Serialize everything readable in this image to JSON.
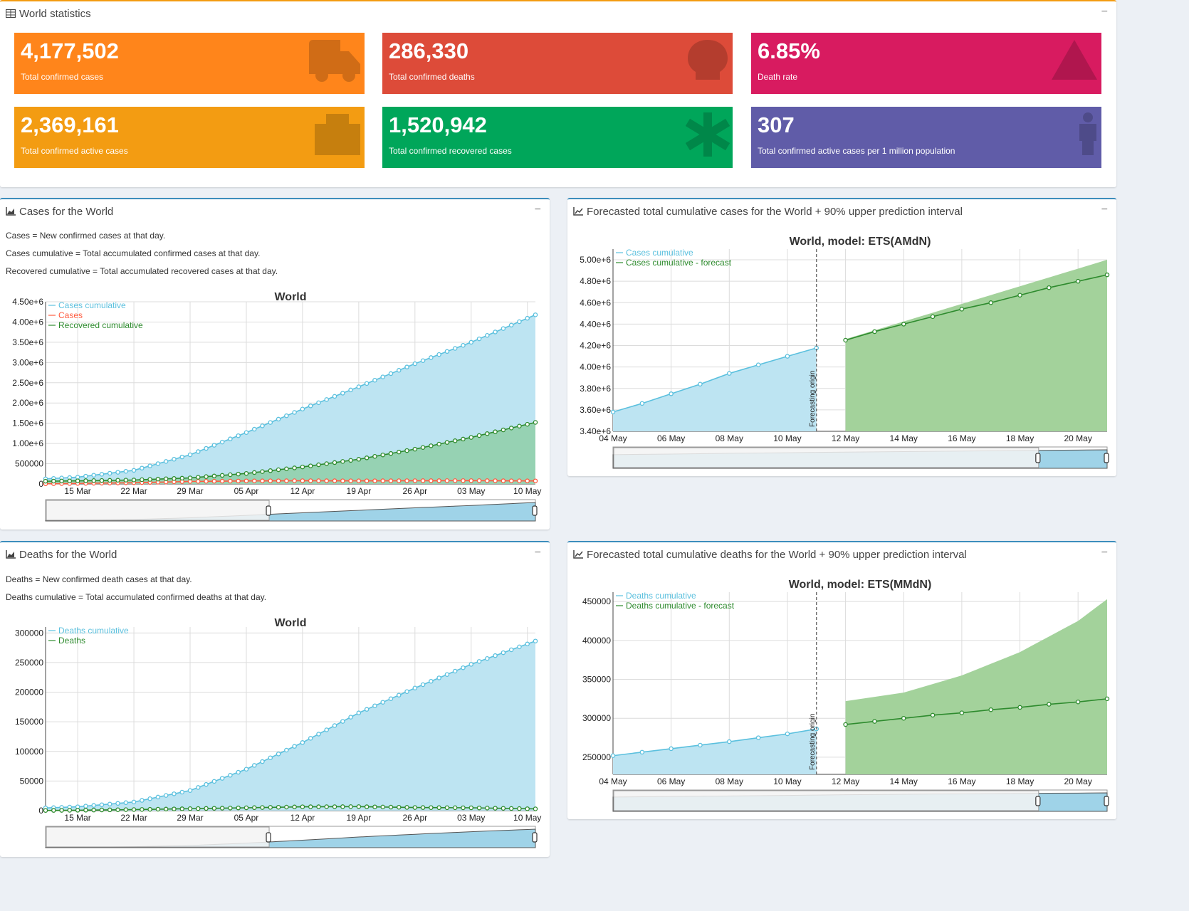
{
  "world_stats": {
    "title": "World statistics",
    "boxes": [
      {
        "value": "4,177,502",
        "label": "Total confirmed cases",
        "color": "#ff851b",
        "icon": "ambulance-icon"
      },
      {
        "value": "286,330",
        "label": "Total confirmed deaths",
        "color": "#dd4b39",
        "icon": "skull-icon"
      },
      {
        "value": "6.85%",
        "label": "Death rate",
        "color": "#d81b60",
        "icon": "warning-icon"
      },
      {
        "value": "2,369,161",
        "label": "Total confirmed active cases",
        "color": "#f39c12",
        "icon": "hospital-icon"
      },
      {
        "value": "1,520,942",
        "label": "Total confirmed recovered cases",
        "color": "#00a65a",
        "icon": "asterisk-icon"
      },
      {
        "value": "307",
        "label": "Total confirmed active cases per 1 million population",
        "color": "#605ca8",
        "icon": "person-icon"
      }
    ]
  },
  "panels": {
    "cases": {
      "title": "Cases for the World",
      "desc": [
        "Cases = New confirmed cases at that day.",
        "Cases cumulative = Total accumulated confirmed cases at that day.",
        "Recovered cumulative = Total accumulated recovered cases at that day."
      ]
    },
    "forecast_cases": {
      "title": "Forecasted total cumulative cases for the World + 90% upper prediction interval"
    },
    "deaths": {
      "title": "Deaths for the World",
      "desc": [
        "Deaths = New confirmed death cases at that day.",
        "Deaths cumulative = Total accumulated confirmed deaths at that day."
      ]
    },
    "forecast_deaths": {
      "title": "Forecasted total cumulative deaths for the World + 90% upper prediction interval"
    }
  },
  "chart_data": [
    {
      "id": "cases",
      "type": "area",
      "title": "World",
      "x_start": "2020-03-11",
      "x_end": "2020-05-11",
      "xticks": [
        "15 Mar",
        "22 Mar",
        "29 Mar",
        "05 Apr",
        "12 Apr",
        "19 Apr",
        "26 Apr",
        "03 May",
        "10 May"
      ],
      "yticks": [
        "0",
        "500000",
        "1.00e+6",
        "1.50e+6",
        "2.00e+6",
        "2.50e+6",
        "3.00e+6",
        "3.50e+6",
        "4.00e+6",
        "4.50e+6"
      ],
      "ylim": [
        0,
        4500000
      ],
      "legend_position": "top-left",
      "series": [
        {
          "name": "Cases cumulative",
          "color": "#5bc0de",
          "fill": "#bde4f2",
          "points": [
            [
              "2020-03-11",
              126000
            ],
            [
              "2020-03-15",
              168000
            ],
            [
              "2020-03-22",
              337000
            ],
            [
              "2020-03-29",
              721000
            ],
            [
              "2020-04-05",
              1270000
            ],
            [
              "2020-04-12",
              1850000
            ],
            [
              "2020-04-19",
              2400000
            ],
            [
              "2020-04-26",
              2970000
            ],
            [
              "2020-05-03",
              3500000
            ],
            [
              "2020-05-11",
              4177502
            ]
          ]
        },
        {
          "name": "Cases",
          "color": "#ff5b3f",
          "fill": null,
          "points": [
            [
              "2020-03-11",
              5000
            ],
            [
              "2020-03-15",
              13000
            ],
            [
              "2020-03-22",
              30000
            ],
            [
              "2020-03-29",
              62000
            ],
            [
              "2020-04-05",
              75000
            ],
            [
              "2020-04-12",
              80000
            ],
            [
              "2020-04-19",
              77000
            ],
            [
              "2020-04-26",
              80000
            ],
            [
              "2020-05-03",
              82000
            ],
            [
              "2020-05-11",
              75000
            ]
          ]
        },
        {
          "name": "Recovered cumulative",
          "color": "#2e8b2e",
          "fill": "#8fcfa8",
          "points": [
            [
              "2020-03-11",
              68000
            ],
            [
              "2020-03-15",
              78000
            ],
            [
              "2020-03-22",
              98000
            ],
            [
              "2020-03-29",
              150000
            ],
            [
              "2020-04-05",
              260000
            ],
            [
              "2020-04-12",
              420000
            ],
            [
              "2020-04-19",
              610000
            ],
            [
              "2020-04-26",
              860000
            ],
            [
              "2020-05-03",
              1150000
            ],
            [
              "2020-05-11",
              1520942
            ]
          ]
        }
      ]
    },
    {
      "id": "forecast_cases",
      "type": "line",
      "title": "World, model: ETS(AMdN)",
      "x_start": "2020-05-04",
      "x_end": "2020-05-21",
      "xticks": [
        "04 May",
        "06 May",
        "08 May",
        "10 May",
        "12 May",
        "14 May",
        "16 May",
        "18 May",
        "20 May"
      ],
      "yticks": [
        "3.40e+6",
        "3.60e+6",
        "3.80e+6",
        "4.00e+6",
        "4.20e+6",
        "4.40e+6",
        "4.60e+6",
        "4.80e+6",
        "5.00e+6"
      ],
      "ylim": [
        3400000,
        5100000
      ],
      "legend_position": "top-left",
      "annotation": "Forecasting origin",
      "origin": "2020-05-11",
      "series": [
        {
          "name": "Cases cumulative",
          "color": "#5bc0de",
          "fill": "#bde4f2",
          "points": [
            [
              "2020-05-04",
              3580000
            ],
            [
              "2020-05-05",
              3660000
            ],
            [
              "2020-05-06",
              3750000
            ],
            [
              "2020-05-07",
              3840000
            ],
            [
              "2020-05-08",
              3940000
            ],
            [
              "2020-05-09",
              4020000
            ],
            [
              "2020-05-10",
              4100000
            ],
            [
              "2020-05-11",
              4177502
            ]
          ]
        },
        {
          "name": "Cases cumulative - forecast",
          "color": "#2e8b2e",
          "fill": "#a3d29b",
          "points": [
            [
              "2020-05-12",
              4250000
            ],
            [
              "2020-05-13",
              4330000
            ],
            [
              "2020-05-14",
              4400000
            ],
            [
              "2020-05-15",
              4470000
            ],
            [
              "2020-05-16",
              4540000
            ],
            [
              "2020-05-17",
              4600000
            ],
            [
              "2020-05-18",
              4670000
            ],
            [
              "2020-05-19",
              4740000
            ],
            [
              "2020-05-20",
              4800000
            ],
            [
              "2020-05-21",
              4860000
            ]
          ]
        }
      ],
      "upper_interval": [
        [
          "2020-05-12",
          4260000
        ],
        [
          "2020-05-21",
          5000000
        ]
      ]
    },
    {
      "id": "deaths",
      "type": "area",
      "title": "World",
      "x_start": "2020-03-11",
      "x_end": "2020-05-11",
      "xticks": [
        "15 Mar",
        "22 Mar",
        "29 Mar",
        "05 Apr",
        "12 Apr",
        "19 Apr",
        "26 Apr",
        "03 May",
        "10 May"
      ],
      "yticks": [
        "0",
        "50000",
        "100000",
        "150000",
        "200000",
        "250000",
        "300000"
      ],
      "ylim": [
        0,
        310000
      ],
      "legend_position": "top-left",
      "series": [
        {
          "name": "Deaths cumulative",
          "color": "#5bc0de",
          "fill": "#bde4f2",
          "points": [
            [
              "2020-03-11",
              4600
            ],
            [
              "2020-03-15",
              6500
            ],
            [
              "2020-03-22",
              14600
            ],
            [
              "2020-03-29",
              34000
            ],
            [
              "2020-04-05",
              70000
            ],
            [
              "2020-04-12",
              115000
            ],
            [
              "2020-04-19",
              165000
            ],
            [
              "2020-04-26",
              207000
            ],
            [
              "2020-05-03",
              247000
            ],
            [
              "2020-05-11",
              286330
            ]
          ]
        },
        {
          "name": "Deaths",
          "color": "#2e8b2e",
          "fill": null,
          "points": [
            [
              "2020-03-11",
              300
            ],
            [
              "2020-03-15",
              700
            ],
            [
              "2020-03-22",
              1800
            ],
            [
              "2020-03-29",
              3300
            ],
            [
              "2020-04-05",
              4800
            ],
            [
              "2020-04-12",
              6500
            ],
            [
              "2020-04-19",
              6800
            ],
            [
              "2020-04-26",
              5300
            ],
            [
              "2020-05-03",
              4800
            ],
            [
              "2020-05-11",
              3000
            ]
          ]
        }
      ]
    },
    {
      "id": "forecast_deaths",
      "type": "line",
      "title": "World, model: ETS(MMdN)",
      "x_start": "2020-05-04",
      "x_end": "2020-05-21",
      "xticks": [
        "04 May",
        "06 May",
        "08 May",
        "10 May",
        "12 May",
        "14 May",
        "16 May",
        "18 May",
        "20 May"
      ],
      "yticks": [
        "250000",
        "300000",
        "350000",
        "400000",
        "450000"
      ],
      "ylim": [
        228000,
        462000
      ],
      "legend_position": "top-left",
      "annotation": "Forecasting origin",
      "origin": "2020-05-11",
      "series": [
        {
          "name": "Deaths cumulative",
          "color": "#5bc0de",
          "fill": "#bde4f2",
          "points": [
            [
              "2020-05-04",
              252000
            ],
            [
              "2020-05-05",
              256500
            ],
            [
              "2020-05-06",
              261000
            ],
            [
              "2020-05-07",
              265500
            ],
            [
              "2020-05-08",
              270000
            ],
            [
              "2020-05-09",
              275000
            ],
            [
              "2020-05-10",
              280000
            ],
            [
              "2020-05-11",
              286330
            ]
          ]
        },
        {
          "name": "Deaths cumulative - forecast",
          "color": "#2e8b2e",
          "fill": "#a3d29b",
          "points": [
            [
              "2020-05-12",
              292000
            ],
            [
              "2020-05-13",
              296000
            ],
            [
              "2020-05-14",
              300000
            ],
            [
              "2020-05-15",
              304000
            ],
            [
              "2020-05-16",
              307000
            ],
            [
              "2020-05-17",
              311000
            ],
            [
              "2020-05-18",
              314000
            ],
            [
              "2020-05-19",
              318000
            ],
            [
              "2020-05-20",
              321000
            ],
            [
              "2020-05-21",
              325000
            ]
          ]
        }
      ],
      "upper_interval": [
        [
          "2020-05-12",
          322000
        ],
        [
          "2020-05-14",
          333000
        ],
        [
          "2020-05-16",
          355000
        ],
        [
          "2020-05-18",
          385000
        ],
        [
          "2020-05-20",
          425000
        ],
        [
          "2020-05-21",
          453000
        ]
      ]
    }
  ]
}
